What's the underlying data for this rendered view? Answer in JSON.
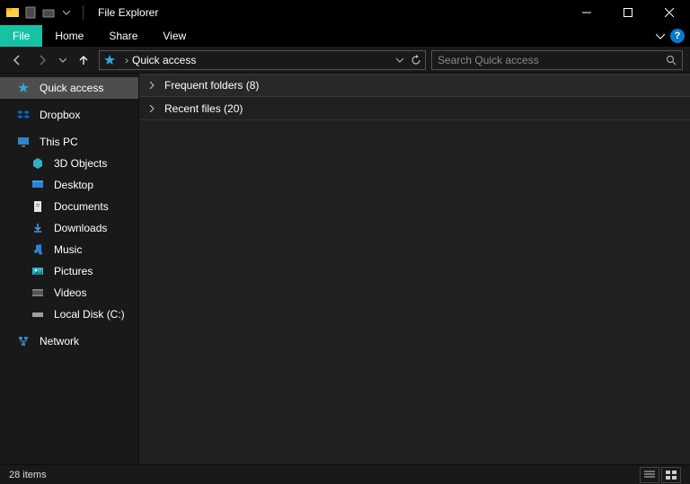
{
  "window": {
    "title": "File Explorer"
  },
  "ribbon": {
    "file": "File",
    "home": "Home",
    "share": "Share",
    "view": "View"
  },
  "addressbar": {
    "crumb1": "Quick access"
  },
  "search": {
    "placeholder": "Search Quick access"
  },
  "nav": {
    "quick_access": "Quick access",
    "dropbox": "Dropbox",
    "this_pc": "This PC",
    "objects3d": "3D Objects",
    "desktop": "Desktop",
    "documents": "Documents",
    "downloads": "Downloads",
    "music": "Music",
    "pictures": "Pictures",
    "videos": "Videos",
    "local_disk": "Local Disk (C:)",
    "network": "Network"
  },
  "content": {
    "frequent_label": "Frequent folders (8)",
    "recent_label": "Recent files (20)"
  },
  "status": {
    "item_count": "28 items"
  }
}
